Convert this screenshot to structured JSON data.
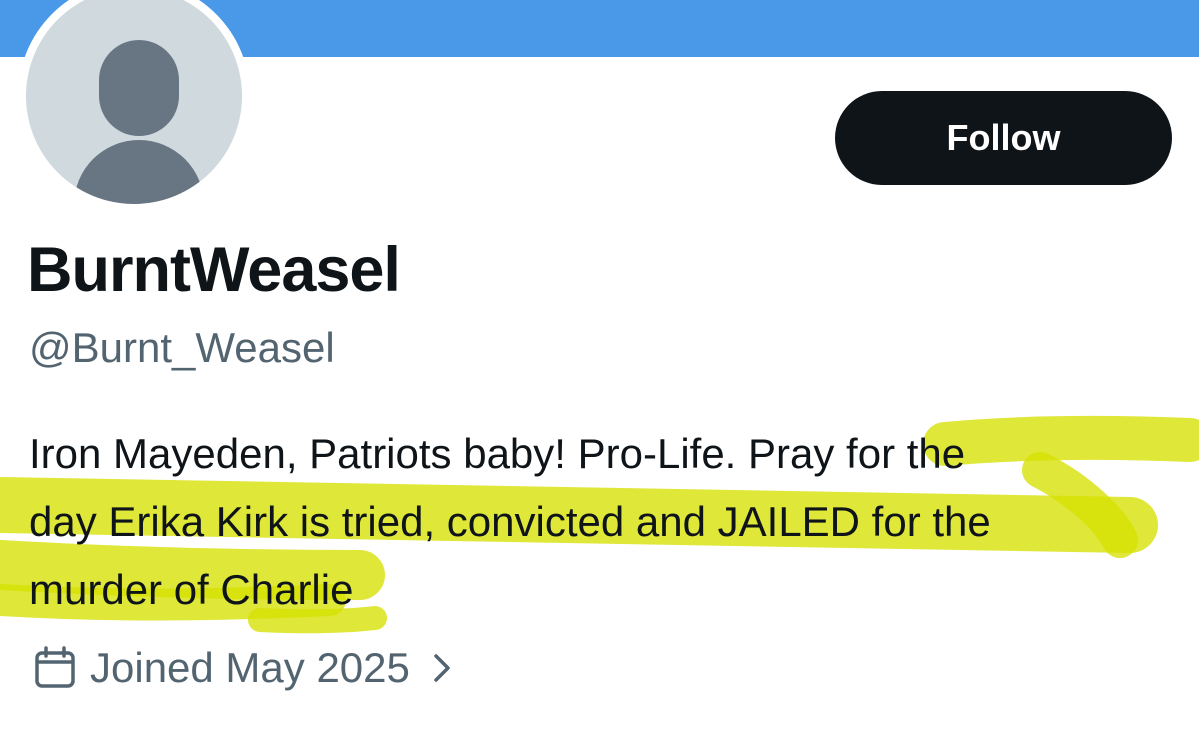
{
  "profile": {
    "display_name": "BurntWeasel",
    "handle": "@Burnt_Weasel",
    "bio_lines": [
      "Iron Mayeden, Patriots baby! Pro-Life. Pray for the",
      "day Erika Kirk is tried, convicted and JAILED for the",
      "murder of Charlie"
    ],
    "joined": "Joined May 2025"
  },
  "actions": {
    "follow_label": "Follow"
  },
  "icons": {
    "calendar": "calendar-icon",
    "chevron": "chevron-right-icon",
    "avatar": "default-avatar-icon"
  },
  "colors": {
    "banner": "#4a99e9",
    "follow_button": "#0f1419",
    "text_primary": "#0f1419",
    "text_secondary": "#536471",
    "avatar_bg": "#cfd9de",
    "avatar_silhouette": "#687684",
    "highlight": "#d6e000"
  }
}
